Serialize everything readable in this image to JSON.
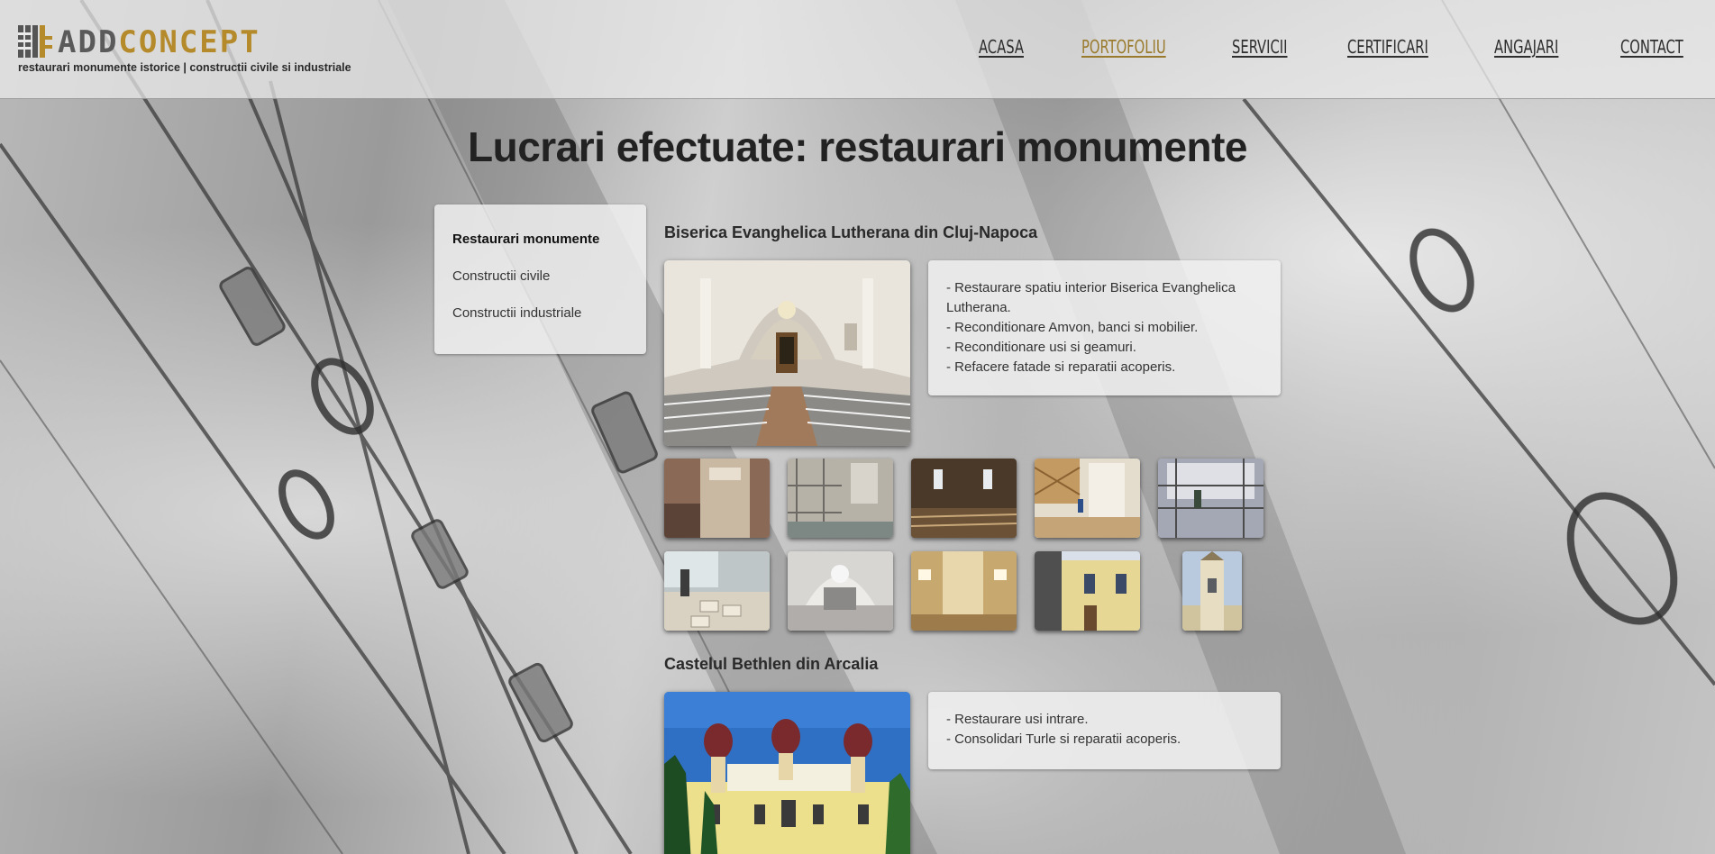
{
  "logo": {
    "brand_add": "ADD",
    "brand_concept": "CONCEPT",
    "tagline": "restaurari monumente istorice | constructii civile si industriale",
    "colors": {
      "add": "#5a5a5a",
      "concept": "#b48a2a"
    }
  },
  "nav": {
    "items": [
      {
        "label": "ACASA",
        "active": false
      },
      {
        "label": "PORTOFOLIU",
        "active": true
      },
      {
        "label": "SERVICII",
        "active": false
      },
      {
        "label": "CERTIFICARI",
        "active": false
      },
      {
        "label": "ANGAJARI",
        "active": false
      },
      {
        "label": "CONTACT",
        "active": false
      }
    ],
    "active_color": "#9a7b2d"
  },
  "page": {
    "title": "Lucrari efectuate: restaurari monumente"
  },
  "sidebar": {
    "items": [
      {
        "label": "Restaurari monumente",
        "active": true
      },
      {
        "label": "Constructii civile",
        "active": false
      },
      {
        "label": "Constructii industriale",
        "active": false
      }
    ]
  },
  "projects": [
    {
      "title": "Biserica Evanghelica Lutherana din Cluj-Napoca",
      "description": [
        "- Restaurare spatiu interior Biserica Evanghelica Lutherana.",
        "- Reconditionare Amvon, banci si mobilier.",
        "- Reconditionare usi si geamuri.",
        "- Refacere fatade si reparatii acoperis."
      ],
      "thumbnail_count": 10
    },
    {
      "title": "Castelul Bethlen din Arcalia",
      "description": [
        "- Restaurare usi intrare.",
        "- Consolidari Turle si reparatii acoperis."
      ],
      "thumbnail_count": 0
    }
  ]
}
